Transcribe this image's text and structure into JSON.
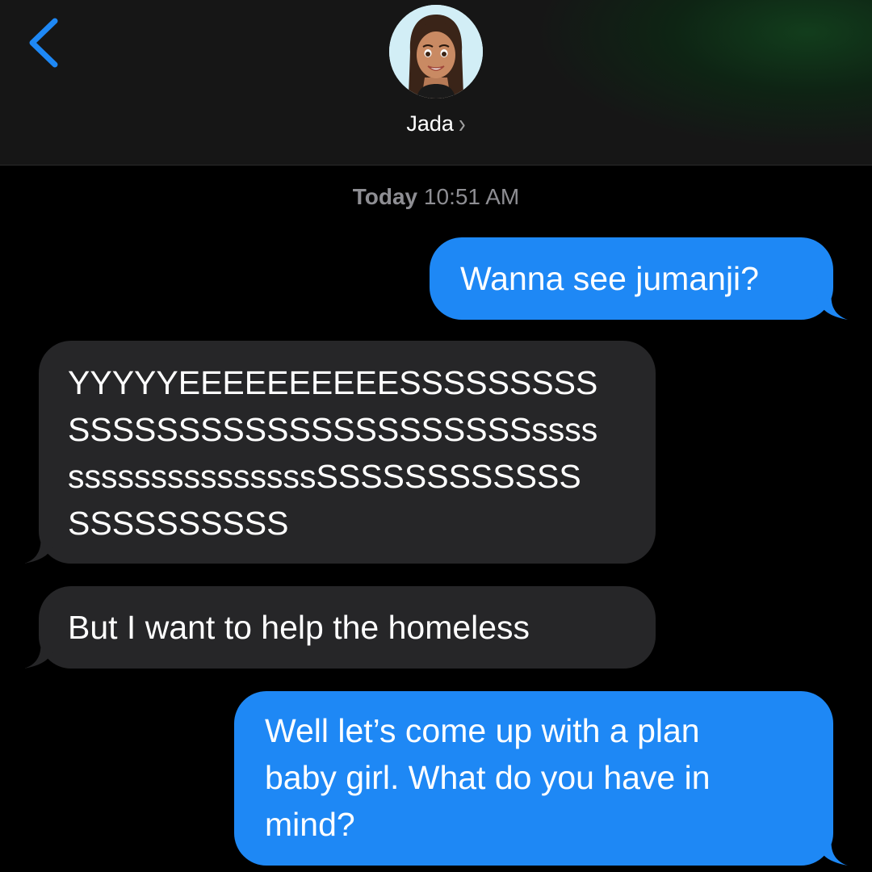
{
  "header": {
    "contact_name": "Jada",
    "name_chevron": "›",
    "back_icon": "chevron-left-icon",
    "avatar": "memoji-avatar"
  },
  "timestamp": {
    "day": "Today",
    "time": "10:51 AM"
  },
  "messages": [
    {
      "direction": "sent",
      "lines": [
        "Wanna see jumanji?"
      ]
    },
    {
      "direction": "received",
      "lines": [
        "YYYYYEEEEEEEEEESSSSSSSSS",
        "SSSSSSSSSSSSSSSSSSSSSssss",
        "sssssssssssssssSSSSSSSSSSSS",
        "SSSSSSSSSS"
      ]
    },
    {
      "direction": "received",
      "lines": [
        "But I want to help the homeless"
      ]
    },
    {
      "direction": "sent",
      "lines": [
        "Well let’s come up with a plan",
        "baby girl. What do you have in",
        "mind?"
      ]
    }
  ],
  "colors": {
    "sent_bubble": "#1e88f5",
    "received_bubble": "#262628",
    "accent": "#1e88f5",
    "background": "#000000"
  }
}
